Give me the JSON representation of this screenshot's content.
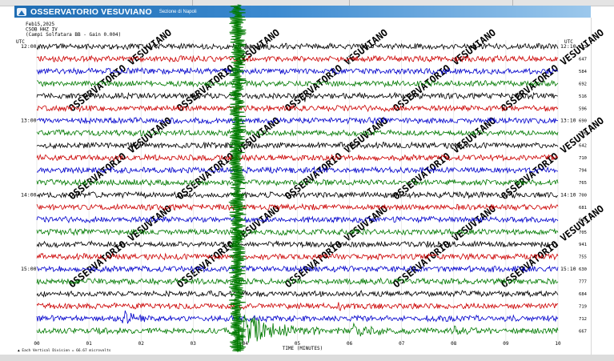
{
  "header": {
    "brand": "OSSERVATORIO VESUVIANO",
    "subtitle": "Sezione di Napoli"
  },
  "chart_data": {
    "type": "line",
    "info": [
      "Feb15,2025",
      "CSOB HHZ IV",
      "(Campi Solfatara BB  - Gain 0.004)"
    ],
    "utc_label": "UTC",
    "left_time_labels": [
      {
        "row": 0,
        "text": "12:00"
      },
      {
        "row": 6,
        "text": "13:00"
      },
      {
        "row": 12,
        "text": "14:00"
      },
      {
        "row": 18,
        "text": "15:00"
      }
    ],
    "right_time_labels": [
      {
        "row": 0,
        "text": "12:10"
      },
      {
        "row": 6,
        "text": "13:10"
      },
      {
        "row": 12,
        "text": "14:10"
      },
      {
        "row": 18,
        "text": "15:10"
      }
    ],
    "x_ticks": [
      "00",
      "01",
      "02",
      "03",
      "04",
      "05",
      "06",
      "07",
      "08",
      "09",
      "10"
    ],
    "xlabel": "TIME (MINUTES)",
    "xlim": [
      0,
      10
    ],
    "footnote": "Each Vertical Division =   66.67 microvolts",
    "row_colors": [
      "#000000",
      "#cc0000",
      "#0000cc",
      "#007a00"
    ],
    "row_scale_values": [
      "573",
      "647",
      "584",
      "692",
      "516",
      "596",
      "690",
      "706",
      "642",
      "710",
      "794",
      "765",
      "700",
      "681",
      "645",
      "705",
      "941",
      "755",
      "630",
      "777",
      "684",
      "719",
      "712",
      "667"
    ],
    "events": [
      {
        "row": 4,
        "minute": 5.15,
        "amplitude": 1.0,
        "duration_min": 0.25,
        "color": "#000000"
      },
      {
        "row": 18,
        "minute": 9.35,
        "amplitude": 0.6,
        "duration_min": 0.1,
        "color": "#0000cc"
      },
      {
        "row": 19,
        "minute": 1.1,
        "amplitude": 0.4,
        "duration_min": 0.1,
        "color": "#000000"
      },
      {
        "row": 21,
        "minute": 5.75,
        "amplitude": 0.5,
        "duration_min": 0.4,
        "color": "#cc0000"
      },
      {
        "row": 22,
        "minute": 1.65,
        "amplitude": 1.4,
        "duration_min": 0.6,
        "color": "#0000cc"
      },
      {
        "row": 22,
        "minute": 3.1,
        "amplitude": 0.4,
        "duration_min": 0.3,
        "color": "#0000cc"
      },
      {
        "row": 23,
        "minute": 6.1,
        "amplitude": 1.2,
        "duration_min": 1.0,
        "color": "#007a00"
      },
      {
        "row": 23,
        "minute": 8.0,
        "amplitude": 0.6,
        "duration_min": 0.6,
        "color": "#007a00"
      }
    ],
    "main_event": {
      "row": 23,
      "minute": 3.85,
      "color": "#007a00"
    },
    "watermark": "OSSERVATORIO VESUVIANO"
  }
}
